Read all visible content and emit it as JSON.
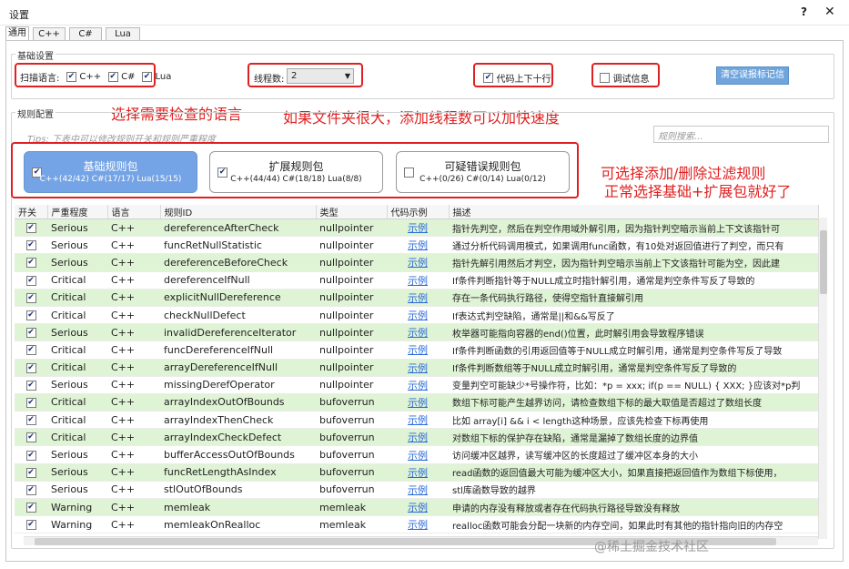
{
  "window": {
    "title": "设置",
    "help": "?",
    "close": "✕"
  },
  "tabs": [
    "通用",
    "C++",
    "C#",
    "Lua"
  ],
  "basic": {
    "group_title": "基础设置",
    "scan_label": "扫描语言:",
    "langs": [
      "C++",
      "C#",
      "Lua"
    ],
    "thread_label": "线程数:",
    "thread_value": "2",
    "code_updown": "代码上下十行",
    "debug": "调试信息",
    "clear_btn": "清空误报标记信息"
  },
  "notes": {
    "lang": "选择需要检查的语言",
    "thread": "如果文件夹很大，添加线程数可以加快速度",
    "filter1": "可选择添加/删除过滤规则",
    "filter2": "正常选择基础+扩展包就好了"
  },
  "rules": {
    "group_title": "规则配置",
    "tips": "Tips: 下表中可以修改规则开关和规则严重程度",
    "search_placeholder": "规则搜索...",
    "packs": [
      {
        "title": "基础规则包",
        "sub": "C++(42/42)  C#(17/17)  Lua(15/15)",
        "checked": true
      },
      {
        "title": "扩展规则包",
        "sub": "C++(44/44)  C#(18/18)  Lua(8/8)",
        "checked": true
      },
      {
        "title": "可疑错误规则包",
        "sub": "C++(0/26)  C#(0/14)  Lua(0/12)",
        "checked": false
      }
    ],
    "headers": [
      "开关",
      "严重程度",
      "语言",
      "规则ID",
      "类型",
      "代码示例",
      "描述"
    ],
    "rows": [
      {
        "severity": "Serious",
        "lang": "C++",
        "id": "dereferenceAfterCheck",
        "type": "nullpointer",
        "link": "示例",
        "desc": "指针先判空，然后在判空作用域外解引用，因为指针判空暗示当前上下文该指针可"
      },
      {
        "severity": "Serious",
        "lang": "C++",
        "id": "funcRetNullStatistic",
        "type": "nullpointer",
        "link": "示例",
        "desc": "通过分析代码调用模式，如果调用func函数，有10处对返回值进行了判空，而只有"
      },
      {
        "severity": "Serious",
        "lang": "C++",
        "id": "dereferenceBeforeCheck",
        "type": "nullpointer",
        "link": "示例",
        "desc": "指针先解引用然后才判空，因为指针判空暗示当前上下文该指针可能为空，因此建"
      },
      {
        "severity": "Critical",
        "lang": "C++",
        "id": "dereferenceIfNull",
        "type": "nullpointer",
        "link": "示例",
        "desc": "If条件判断指针等于NULL成立时指针解引用，通常是判空条件写反了导致的"
      },
      {
        "severity": "Critical",
        "lang": "C++",
        "id": "explicitNullDereference",
        "type": "nullpointer",
        "link": "示例",
        "desc": "存在一条代码执行路径，使得空指针直接解引用"
      },
      {
        "severity": "Critical",
        "lang": "C++",
        "id": "checkNullDefect",
        "type": "nullpointer",
        "link": "示例",
        "desc": "If表达式判空缺陷，通常是||和&&写反了"
      },
      {
        "severity": "Serious",
        "lang": "C++",
        "id": "invalidDereferenceIterator",
        "type": "nullpointer",
        "link": "示例",
        "desc": "枚举器可能指向容器的end()位置，此时解引用会导致程序错误"
      },
      {
        "severity": "Critical",
        "lang": "C++",
        "id": "funcDereferenceIfNull",
        "type": "nullpointer",
        "link": "示例",
        "desc": "If条件判断函数的引用返回值等于NULL成立时解引用，通常是判空条件写反了导致"
      },
      {
        "severity": "Critical",
        "lang": "C++",
        "id": "arrayDereferenceIfNull",
        "type": "nullpointer",
        "link": "示例",
        "desc": "If条件判断数组等于NULL成立时解引用，通常是判空条件写反了导致的"
      },
      {
        "severity": "Serious",
        "lang": "C++",
        "id": "missingDerefOperator",
        "type": "nullpointer",
        "link": "示例",
        "desc": "变量判空可能缺少*号操作符，比如：*p = xxx; if(p == NULL) { XXX; }应该对*p判"
      },
      {
        "severity": "Critical",
        "lang": "C++",
        "id": "arrayIndexOutOfBounds",
        "type": "bufoverrun",
        "link": "示例",
        "desc": "数组下标可能产生越界访问，请检查数组下标的最大取值是否超过了数组长度"
      },
      {
        "severity": "Critical",
        "lang": "C++",
        "id": "arrayIndexThenCheck",
        "type": "bufoverrun",
        "link": "示例",
        "desc": "比如 array[i] && i < length这种场景，应该先检查下标再使用"
      },
      {
        "severity": "Critical",
        "lang": "C++",
        "id": "arrayIndexCheckDefect",
        "type": "bufoverrun",
        "link": "示例",
        "desc": "对数组下标的保护存在缺陷，通常是漏掉了数组长度的边界值"
      },
      {
        "severity": "Serious",
        "lang": "C++",
        "id": "bufferAccessOutOfBounds",
        "type": "bufoverrun",
        "link": "示例",
        "desc": "访问缓冲区越界，读写缓冲区的长度超过了缓冲区本身的大小"
      },
      {
        "severity": "Serious",
        "lang": "C++",
        "id": "funcRetLengthAsIndex",
        "type": "bufoverrun",
        "link": "示例",
        "desc": "read函数的返回值最大可能为缓冲区大小，如果直接把返回值作为数组下标使用，"
      },
      {
        "severity": "Serious",
        "lang": "C++",
        "id": "stlOutOfBounds",
        "type": "bufoverrun",
        "link": "示例",
        "desc": "stl库函数导致的越界"
      },
      {
        "severity": "Warning",
        "lang": "C++",
        "id": "memleak",
        "type": "memleak",
        "link": "示例",
        "desc": "申请的内存没有释放或者存在代码执行路径导致没有释放"
      },
      {
        "severity": "Warning",
        "lang": "C++",
        "id": "memleakOnRealloc",
        "type": "memleak",
        "link": "示例",
        "desc": "realloc函数可能会分配一块新的内存空间，如果此时有其他的指针指向旧的内存空"
      }
    ]
  },
  "watermark": "@稀土掘金技术社区",
  "colors": {
    "accent": "#74a4e6",
    "highlight_row": "#dff3d5",
    "note_red": "#e02020",
    "link": "#2a6ad8"
  }
}
